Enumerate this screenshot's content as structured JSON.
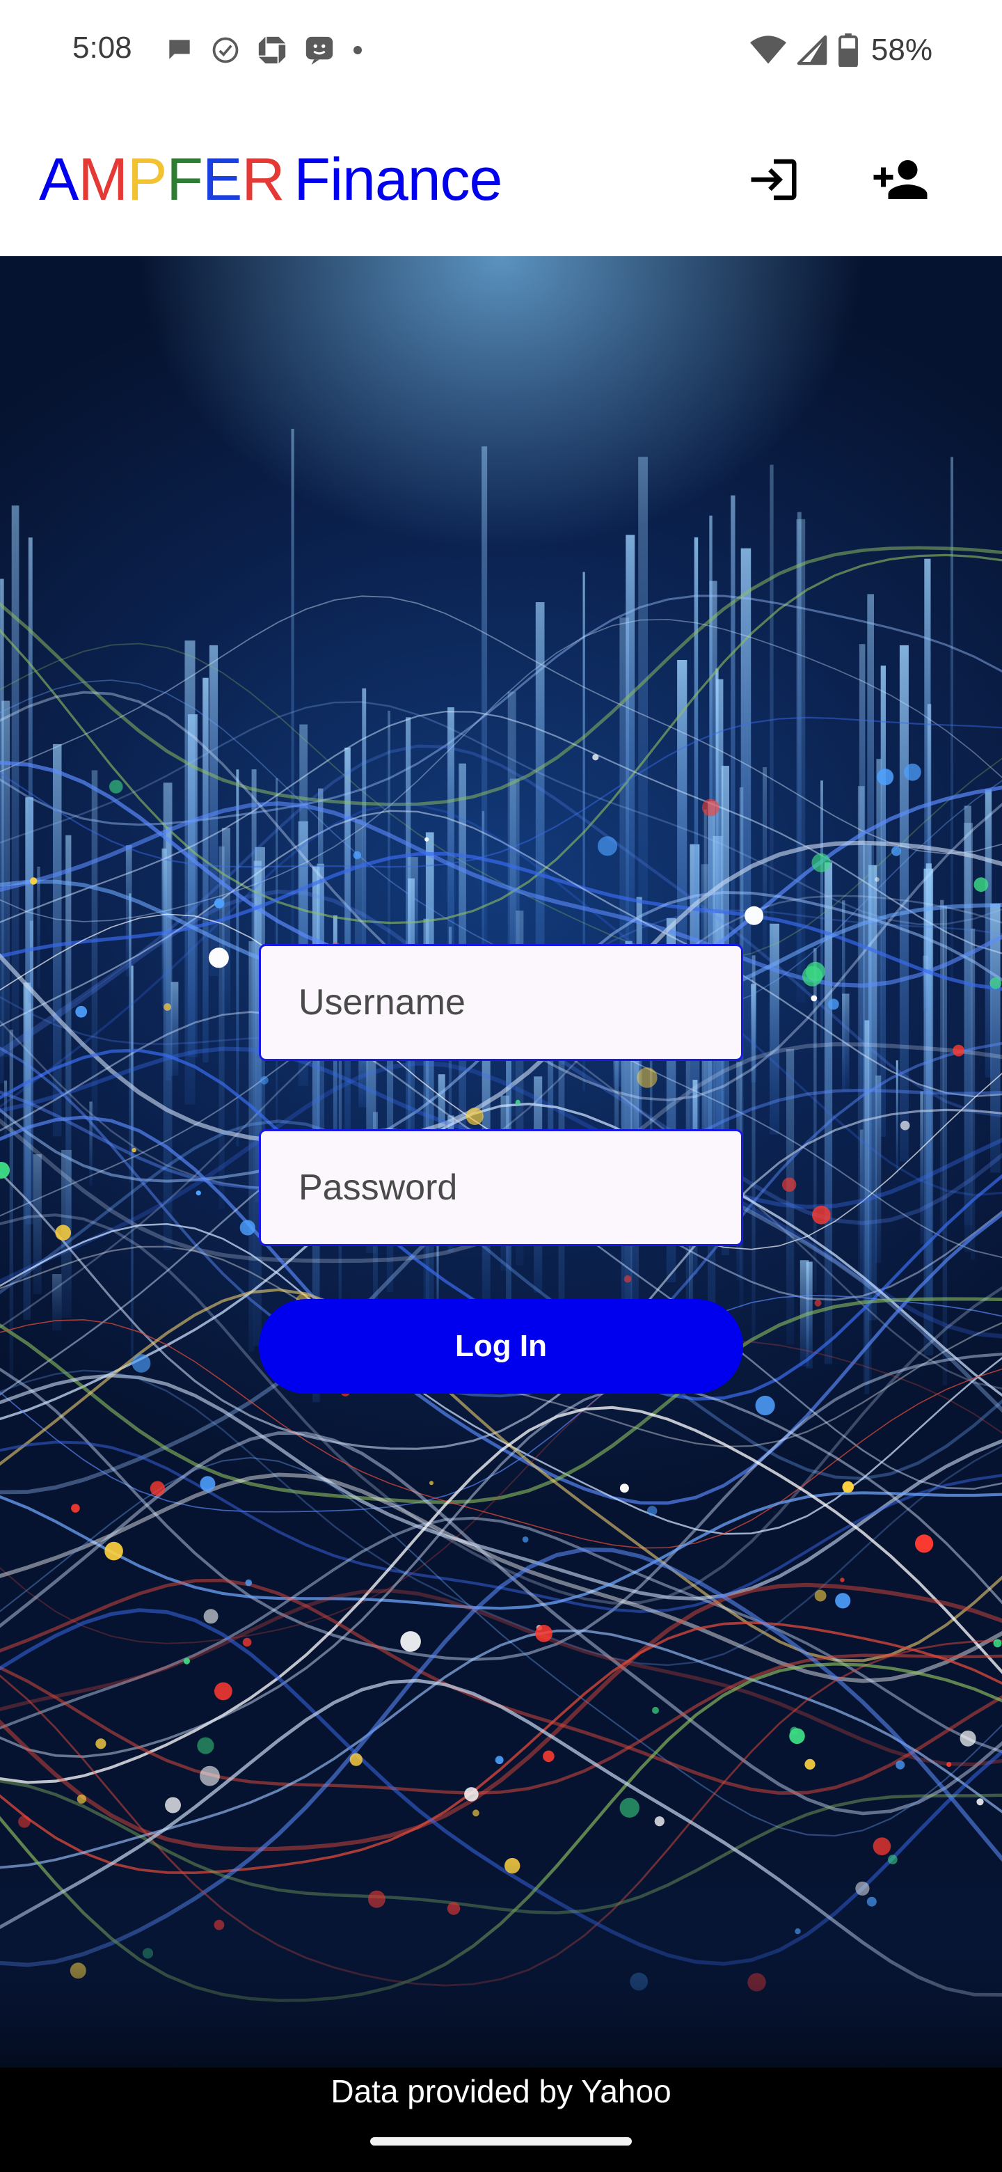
{
  "status_bar": {
    "time": "5:08",
    "battery": "58%",
    "notification_icons": [
      "chat-bubble-icon",
      "check-circle-icon",
      "chase-bank-icon",
      "messenger-app-icon",
      "more-dot-icon"
    ],
    "system_icons": [
      "wifi-icon",
      "cellular-signal-icon",
      "battery-icon"
    ]
  },
  "app_bar": {
    "brand_letters": [
      {
        "char": "A",
        "color": "#0000ee"
      },
      {
        "char": "M",
        "color": "#e53935"
      },
      {
        "char": "P",
        "color": "#f2c230"
      },
      {
        "char": "F",
        "color": "#2e7d32"
      },
      {
        "char": "E",
        "color": "#1a3fe0"
      },
      {
        "char": "R",
        "color": "#e53935"
      }
    ],
    "brand_suffix": "Finance",
    "brand_suffix_color": "#0000ee",
    "actions": [
      "login-icon",
      "person-add-icon"
    ]
  },
  "login_form": {
    "username_placeholder": "Username",
    "username_value": "",
    "password_placeholder": "Password",
    "password_value": "",
    "submit_label": "Log In",
    "submit_color": "#0000ee"
  },
  "footer": {
    "attribution": "Data provided by Yahoo"
  }
}
